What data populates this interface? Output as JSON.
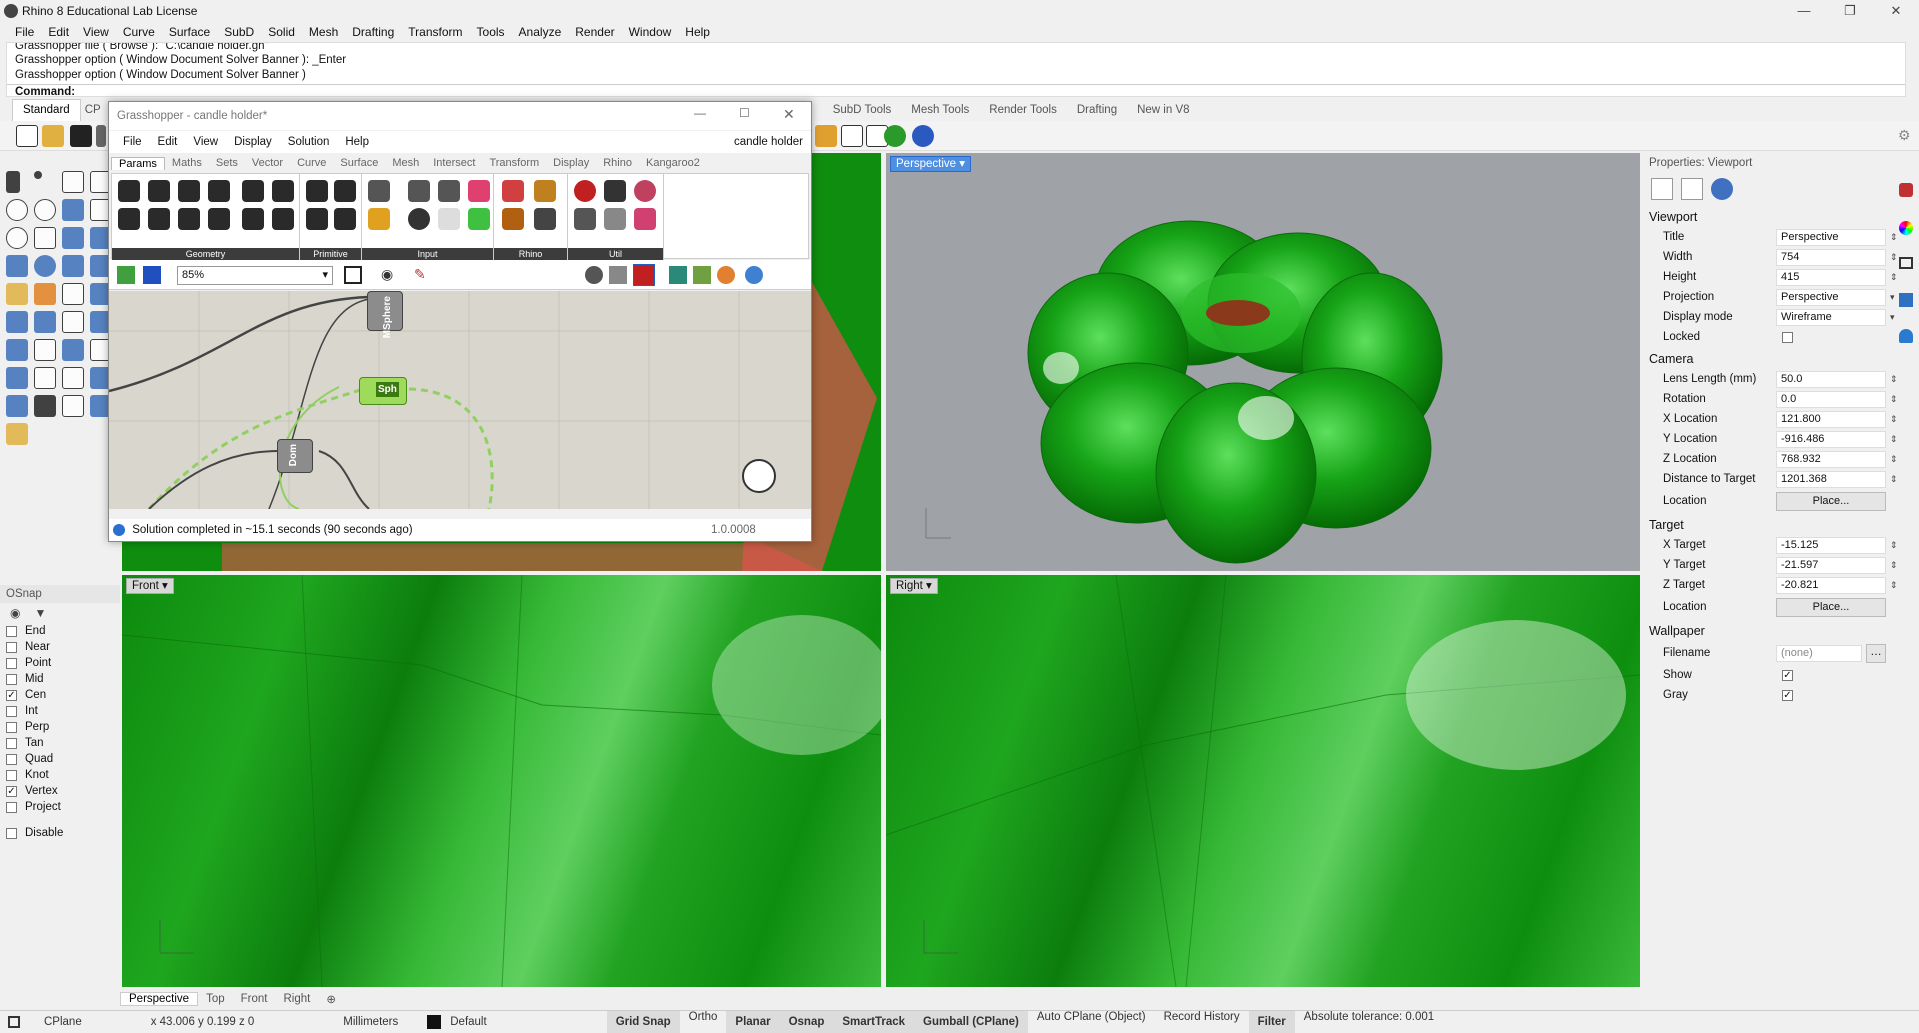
{
  "window": {
    "title": "Rhino 8 Educational Lab License"
  },
  "menu": [
    "File",
    "Edit",
    "View",
    "Curve",
    "Surface",
    "SubD",
    "Solid",
    "Mesh",
    "Drafting",
    "Transform",
    "Tools",
    "Analyze",
    "Render",
    "Window",
    "Help"
  ],
  "command": {
    "lines": [
      "Grasshopper file ( Browse ): \"C:\\candle holder.gh\"",
      "Grasshopper option ( Window  Document  Solver  Banner ): _Enter",
      "Grasshopper option ( Window  Document  Solver  Banner )"
    ],
    "prompt": "Command:"
  },
  "toolbar_tabs": [
    "Standard",
    "CPlanes",
    "SubD Tools",
    "Mesh Tools",
    "Render Tools",
    "Drafting",
    "New in V8"
  ],
  "grasshopper": {
    "title": "Grasshopper - candle holder*",
    "doc_name": "candle holder",
    "menu": [
      "File",
      "Edit",
      "View",
      "Display",
      "Solution",
      "Help"
    ],
    "tabs": [
      "Params",
      "Maths",
      "Sets",
      "Vector",
      "Curve",
      "Surface",
      "Mesh",
      "Intersect",
      "Transform",
      "Display",
      "Rhino",
      "Kangaroo2"
    ],
    "groups": [
      "Geometry",
      "Primitive",
      "Input",
      "Rhino",
      "Util"
    ],
    "zoom": "85%",
    "nodes": {
      "msphere": "MSphere",
      "sph": "Sph",
      "dom": "Dom"
    },
    "status": "Solution completed in ~15.1 seconds (90 seconds ago)",
    "version": "1.0.0008"
  },
  "viewports": {
    "perspective": "Perspective",
    "front": "Front",
    "right": "Right"
  },
  "viewport_tabs": [
    "Perspective",
    "Top",
    "Front",
    "Right"
  ],
  "osnap": {
    "title": "OSnap",
    "items": [
      {
        "label": "End",
        "checked": false
      },
      {
        "label": "Near",
        "checked": false
      },
      {
        "label": "Point",
        "checked": false
      },
      {
        "label": "Mid",
        "checked": false
      },
      {
        "label": "Cen",
        "checked": true
      },
      {
        "label": "Int",
        "checked": false
      },
      {
        "label": "Perp",
        "checked": false
      },
      {
        "label": "Tan",
        "checked": false
      },
      {
        "label": "Quad",
        "checked": false
      },
      {
        "label": "Knot",
        "checked": false
      },
      {
        "label": "Vertex",
        "checked": true
      },
      {
        "label": "Project",
        "checked": false
      }
    ],
    "disable": "Disable"
  },
  "properties": {
    "title": "Properties: Viewport",
    "viewport_section": "Viewport",
    "viewport_rows": [
      {
        "k": "Title",
        "v": "Perspective"
      },
      {
        "k": "Width",
        "v": "754"
      },
      {
        "k": "Height",
        "v": "415"
      },
      {
        "k": "Projection",
        "v": "Perspective"
      },
      {
        "k": "Display mode",
        "v": "Wireframe"
      }
    ],
    "locked": "Locked",
    "camera_section": "Camera",
    "camera_rows": [
      {
        "k": "Lens Length (mm)",
        "v": "50.0"
      },
      {
        "k": "Rotation",
        "v": "0.0"
      },
      {
        "k": "X Location",
        "v": "121.800"
      },
      {
        "k": "Y Location",
        "v": "-916.486"
      },
      {
        "k": "Z Location",
        "v": "768.932"
      },
      {
        "k": "Distance to Target",
        "v": "1201.368"
      }
    ],
    "location": "Location",
    "place": "Place...",
    "target_section": "Target",
    "target_rows": [
      {
        "k": "X Target",
        "v": "-15.125"
      },
      {
        "k": "Y Target",
        "v": "-21.597"
      },
      {
        "k": "Z Target",
        "v": "-20.821"
      }
    ],
    "wallpaper_section": "Wallpaper",
    "filename_label": "Filename",
    "filename_value": "(none)",
    "show": "Show",
    "gray": "Gray"
  },
  "status": {
    "cplane": "CPlane",
    "coords": "x 43.006  y 0.199  z 0",
    "units": "Millimeters",
    "layer": "Default",
    "items": [
      {
        "label": "Grid Snap",
        "on": true
      },
      {
        "label": "Ortho",
        "on": false
      },
      {
        "label": "Planar",
        "on": true
      },
      {
        "label": "Osnap",
        "on": true
      },
      {
        "label": "SmartTrack",
        "on": true
      },
      {
        "label": "Gumball (CPlane)",
        "on": true
      },
      {
        "label": "Auto CPlane (Object)",
        "on": false
      },
      {
        "label": "Record History",
        "on": false
      },
      {
        "label": "Filter",
        "on": true
      },
      {
        "label": "Absolute tolerance: 0.001",
        "on": false
      }
    ]
  },
  "colors": {
    "accent": "#0078d4",
    "green": "#1fa61f",
    "gh_canvas": "#d9d6cd"
  }
}
